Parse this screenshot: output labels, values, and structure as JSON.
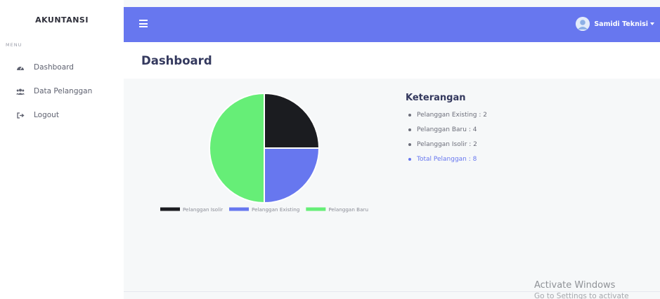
{
  "sidebar": {
    "brand": "AKUNTANSI",
    "menu_heading": "MENU",
    "items": [
      {
        "label": "Dashboard",
        "icon": "tachometer-icon"
      },
      {
        "label": "Data Pelanggan",
        "icon": "users-icon"
      },
      {
        "label": "Logout",
        "icon": "sign-out-icon"
      }
    ]
  },
  "topbar": {
    "user_name": "Samidi Teknisi",
    "color": "#6777ef"
  },
  "page": {
    "title": "Dashboard"
  },
  "keterangan": {
    "title": "Keterangan",
    "items": [
      "Pelanggan Existing : 2",
      "Pelanggan Baru : 4",
      "Pelanggan Isolir : 2",
      "Total Pelanggan : 8"
    ]
  },
  "chart_data": {
    "type": "pie",
    "title": "",
    "legend_position": "bottom",
    "series": [
      {
        "name": "Pelanggan Isolir",
        "value": 2,
        "color": "#1b1c20"
      },
      {
        "name": "Pelanggan Existing",
        "value": 2,
        "color": "#6777ef"
      },
      {
        "name": "Pelanggan Baru",
        "value": 4,
        "color": "#66ee77"
      }
    ]
  },
  "watermark": {
    "line1": "Activate Windows",
    "line2": "Go to Settings to activate Windows."
  }
}
